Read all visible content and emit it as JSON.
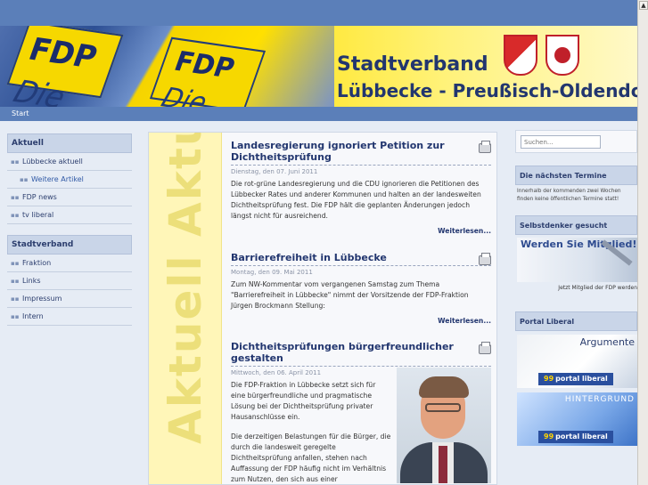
{
  "header": {
    "flag_text": "FDP",
    "flag_sub": "Die Liberalen",
    "title": "Stadtverband",
    "subtitle": "Lübbecke - Preußisch-Oldendorf"
  },
  "breadcrumb": {
    "label": "Start"
  },
  "leftnav": {
    "section1": {
      "heading": "Aktuell",
      "items": [
        {
          "label": "Lübbecke aktuell"
        },
        {
          "label": "Weitere Artikel"
        },
        {
          "label": "FDP news"
        },
        {
          "label": "tv liberal"
        }
      ]
    },
    "section2": {
      "heading": "Stadtverband",
      "items": [
        {
          "label": "Fraktion"
        },
        {
          "label": "Links"
        },
        {
          "label": "Impressum"
        },
        {
          "label": "Intern"
        }
      ]
    }
  },
  "content": {
    "strip_text": "Aktuell Aktuell",
    "articles": [
      {
        "title": "Landesregierung ignoriert Petition zur Dichtheitsprüfung",
        "date": "Dienstag, den 07. Juni 2011",
        "text": "Die rot-grüne Landesregierung und die CDU ignorieren die Petitionen des Lübbecker Rates und anderer Kommunen und halten an der landesweiten Dichtheitsprüfung fest. Die FDP hält die geplanten Änderungen jedoch längst nicht für ausreichend.",
        "more": "Weiterlesen..."
      },
      {
        "title": "Barrierefreiheit in Lübbecke",
        "date": "Montag, den 09. Mai 2011",
        "text": "Zum NW-Kommentar vom vergangenen Samstag zum Thema \"Barrierefreiheit in Lübbecke\" nimmt der Vorsitzende der FDP-Fraktion Jürgen Brockmann Stellung:",
        "more": "Weiterlesen..."
      },
      {
        "title": "Dichtheitsprüfungen bürgerfreundlicher gestalten",
        "date": "Mittwoch, den 06. April 2011",
        "text": "Die FDP-Fraktion in Lübbecke setzt sich für eine bürgerfreundliche und pragmatische Lösung bei der Dichtheitsprüfung privater Hausanschlüsse ein.",
        "text2": "Die derzeitigen Belastungen für die Bürger, die durch die landesweit geregelte Dichtheitsprüfung anfallen, stehen nach Auffassung der FDP häufig nicht im Verhältnis zum Nutzen, den sich aus einer"
      }
    ]
  },
  "rightbar": {
    "search_placeholder": "Suchen...",
    "termine_heading": "Die nächsten Termine",
    "termine_text": "Innerhalb der kommenden zwei Wochen finden keine öffentlichen Termine statt!",
    "selbst_heading": "Selbstdenker gesucht",
    "mitglied_text": "Werden Sie Mitglied!",
    "mitglied_caption": "Jetzt Mitglied der FDP werden",
    "portal_heading": "Portal Liberal",
    "portal1_head": "Argumente",
    "portal2_head": "HINTERGRUND",
    "portal_tag": "portal liberal",
    "portal_quote": "99"
  },
  "colors": {
    "brand_blue": "#5b7fb9",
    "title_blue": "#22366f",
    "fdp_yellow": "#ffe000"
  }
}
